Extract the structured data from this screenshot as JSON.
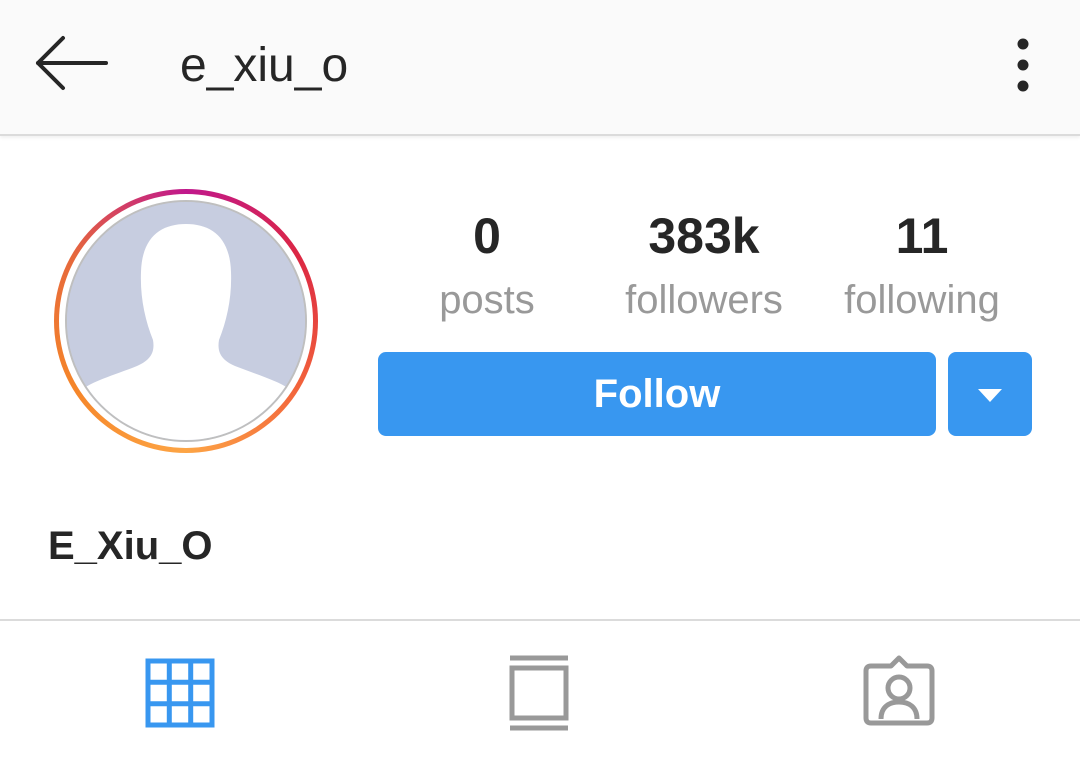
{
  "header": {
    "username": "e_xiu_o",
    "back_icon": "arrow-left-icon",
    "more_icon": "vertical-dots-icon"
  },
  "profile": {
    "avatar_icon": "default-avatar-icon",
    "full_name": "E_Xiu_O"
  },
  "stats": {
    "posts": {
      "value": "0",
      "label": "posts"
    },
    "followers": {
      "value": "383k",
      "label": "followers"
    },
    "following": {
      "value": "11",
      "label": "following"
    }
  },
  "actions": {
    "follow_label": "Follow",
    "dropdown_icon": "caret-down-icon"
  },
  "tabs": [
    {
      "name": "grid",
      "icon": "grid-icon",
      "active": true
    },
    {
      "name": "feed",
      "icon": "feed-icon",
      "active": false
    },
    {
      "name": "tagged",
      "icon": "tagged-person-icon",
      "active": false
    }
  ],
  "colors": {
    "accent": "#3897f0",
    "active_tab": "#3897f0",
    "inactive_tab": "#999999",
    "text": "#262626",
    "muted": "#999999"
  }
}
